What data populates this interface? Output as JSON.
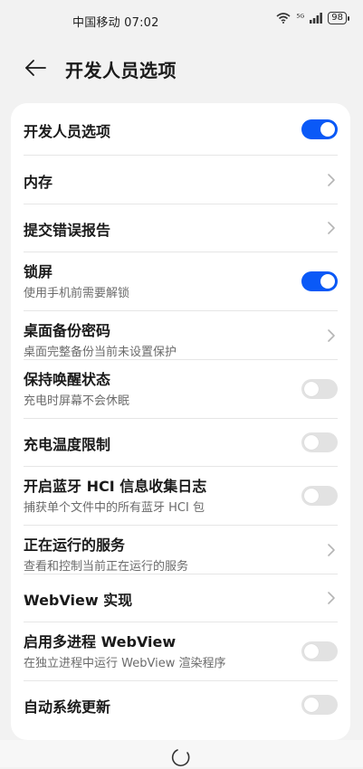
{
  "status_bar": {
    "carrier_time": "中国移动 07:02",
    "network": "⁵ᴳ",
    "battery": "98"
  },
  "header": {
    "title": "开发人员选项"
  },
  "settings": [
    {
      "title": "开发人员选项",
      "subtitle": "",
      "control": "toggle",
      "on": true
    },
    {
      "title": "内存",
      "subtitle": "",
      "control": "chevron"
    },
    {
      "title": "提交错误报告",
      "subtitle": "",
      "control": "chevron"
    },
    {
      "title": "锁屏",
      "subtitle": "使用手机前需要解锁",
      "control": "toggle",
      "on": true
    },
    {
      "title": "桌面备份密码",
      "subtitle": "桌面完整备份当前未设置保护",
      "control": "chevron"
    },
    {
      "title": "保持唤醒状态",
      "subtitle": "充电时屏幕不会休眠",
      "control": "toggle",
      "on": false
    },
    {
      "title": "充电温度限制",
      "subtitle": "",
      "control": "toggle",
      "on": false
    },
    {
      "title": "开启蓝牙 HCI 信息收集日志",
      "subtitle": "捕获单个文件中的所有蓝牙 HCI 包",
      "control": "toggle",
      "on": false
    },
    {
      "title": "正在运行的服务",
      "subtitle": "查看和控制当前正在运行的服务",
      "control": "chevron"
    },
    {
      "title": "WebView 实现",
      "subtitle": "",
      "control": "chevron"
    },
    {
      "title": "启用多进程 WebView",
      "subtitle": "在独立进程中运行 WebView 渲染程序",
      "control": "toggle",
      "on": false
    },
    {
      "title": "自动系统更新",
      "subtitle": "",
      "control": "toggle",
      "on": false
    }
  ],
  "colors": {
    "accent": "#0a59f7",
    "toggle_off": "#e2e2e2",
    "background": "#f2f2f2"
  }
}
